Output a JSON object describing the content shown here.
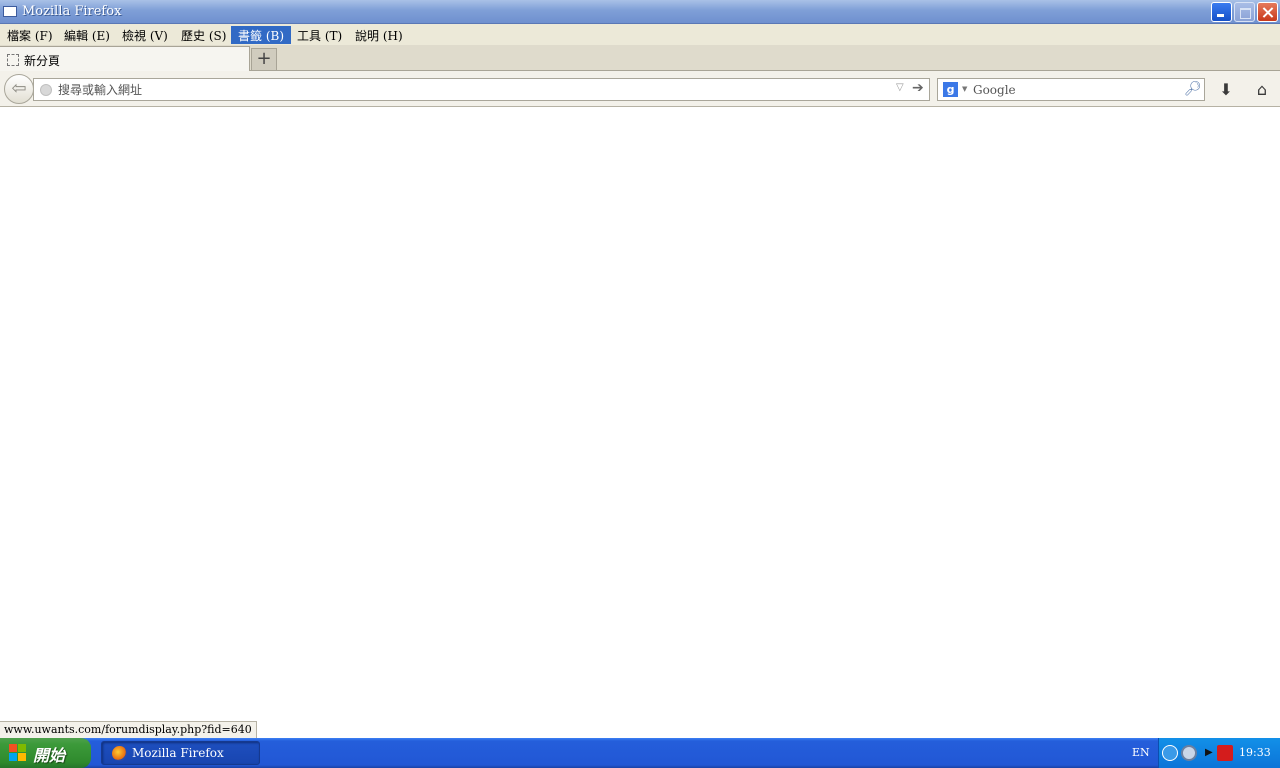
{
  "window": {
    "title": "Mozilla Firefox"
  },
  "menu": {
    "items": [
      {
        "label": "檔案 (F)"
      },
      {
        "label": "編輯 (E)"
      },
      {
        "label": "檢視 (V)"
      },
      {
        "label": "歷史 (S)"
      },
      {
        "label": "書籤 (B)"
      },
      {
        "label": "工具 (T)"
      },
      {
        "label": "說明 (H)"
      }
    ],
    "active": "書籤 (B)"
  },
  "tabs": [
    {
      "label": "新分頁",
      "active": true
    }
  ],
  "new_tab_symbol": "+",
  "address_bar": {
    "placeholder": "搜尋或輸入網址",
    "value": ""
  },
  "search_bar": {
    "engine": "Google",
    "placeholder": "Google",
    "value": ""
  },
  "status": {
    "text": "www.uwants.com/forumdisplay.php?fid=640"
  },
  "taskbar": {
    "start_label": "開始",
    "tasks": [
      {
        "label": "Mozilla Firefox"
      }
    ],
    "language": "EN",
    "clock": "19:33"
  },
  "icons": {
    "back": "back-arrow-icon",
    "globe": "globe-icon",
    "go": "go-arrow-icon",
    "search": "magnifier-icon",
    "download": "download-icon",
    "home": "home-icon"
  },
  "colors": {
    "titlebar": "#7f9fd7",
    "menu_active": "#316ac5",
    "taskbar": "#245edb",
    "start": "#3c9a3a",
    "close": "#c8391b"
  }
}
